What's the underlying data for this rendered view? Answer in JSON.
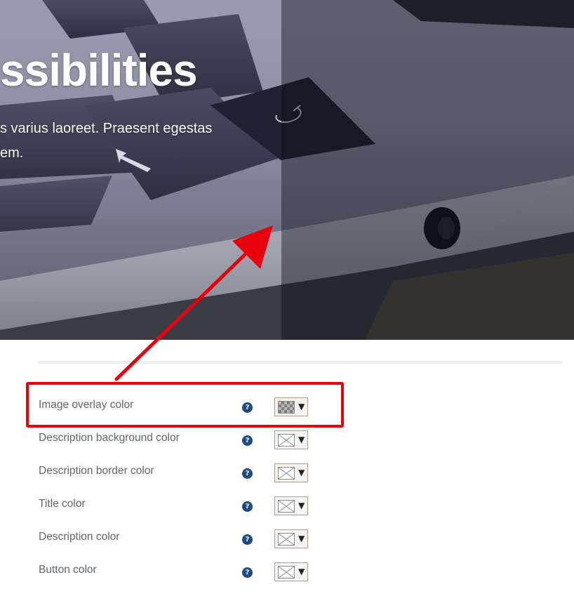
{
  "hero": {
    "title": "ssibilities",
    "description": "s varius laoreet. Praesent egestas em."
  },
  "colors": {
    "overlay": "rgba(10,14,24,0.42)",
    "help_icon": "#1f4b85",
    "annotation": "#e8000d"
  },
  "settings": {
    "rows": [
      {
        "label": "Image overlay color",
        "help_icon": "question-circle-icon",
        "swatch": "transparent-checker",
        "dropdown_arrow": "▼"
      },
      {
        "label": "Description background color",
        "help_icon": "question-circle-icon",
        "swatch": "none",
        "dropdown_arrow": "▼"
      },
      {
        "label": "Description border color",
        "help_icon": "question-circle-icon",
        "swatch": "none",
        "dropdown_arrow": "▼"
      },
      {
        "label": "Title color",
        "help_icon": "question-circle-icon",
        "swatch": "none",
        "dropdown_arrow": "▼"
      },
      {
        "label": "Description color",
        "help_icon": "question-circle-icon",
        "swatch": "none",
        "dropdown_arrow": "▼"
      },
      {
        "label": "Button color",
        "help_icon": "question-circle-icon",
        "swatch": "none",
        "dropdown_arrow": "▼"
      }
    ]
  },
  "help_glyph": "?"
}
